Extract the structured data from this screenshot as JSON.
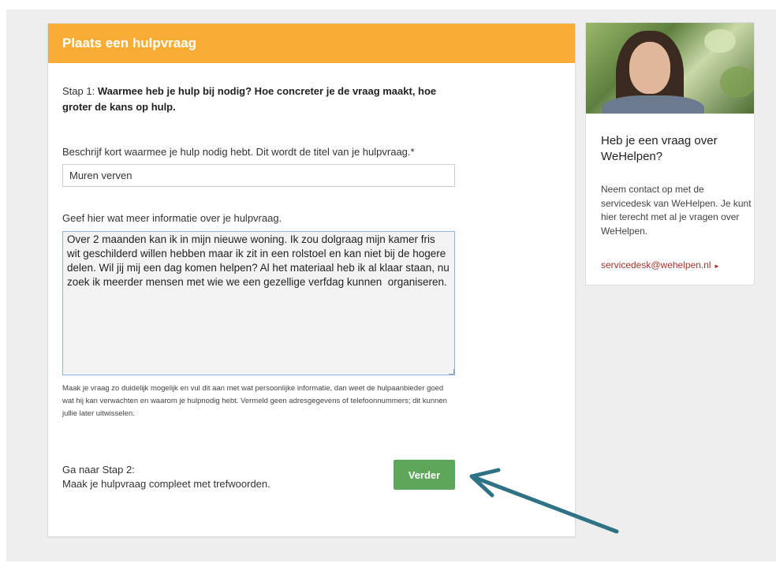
{
  "form": {
    "header_title": "Plaats een hulpvraag",
    "step_text_prefix": "Stap 1: ",
    "step_text_bold": "Waarmee heb je hulp bij nodig? Hoe concreter je de vraag maakt, hoe groter de kans op hulp.",
    "title_label": "Beschrijf kort waarmee je hulp nodig hebt. Dit wordt de titel van je hulpvraag.*",
    "title_value": "Muren verven",
    "info_label": "Geef hier wat meer informatie over je hulpvraag.",
    "info_value": "Over 2 maanden kan ik in mijn nieuwe woning. Ik zou dolgraag mijn kamer fris wit geschilderd willen hebben maar ik zit in een rolstoel en kan niet bij de hogere delen. Wil jij mij een dag komen helpen? Al het materiaal heb ik al klaar staan, nu zoek ik meerder mensen met wie we een gezellige verfdag kunnen  organiseren.",
    "help_text": "Maak je vraag zo duidelijk mogelijk en vul dit aan met wat persoonlijke informatie, dan weet de hulpaanbieder goed wat hij kan verwachten en waarom je hulpnodig hebt. Vermeld geen adresgegevens of telefoonnummers; dit kunnen jullie later uitwisselen.",
    "next_step_line1": "Ga naar Stap 2:",
    "next_step_line2": "Maak je hulpvraag compleet met trefwoorden.",
    "next_button_label": "Verder"
  },
  "sidebar": {
    "heading": "Heb je een vraag over WeHelpen?",
    "body": "Neem contact op met de servicedesk van WeHelpen. Je kunt hier terecht met al je vragen over WeHelpen.",
    "link_label": "servicedesk@wehelpen.nl",
    "link_arrow": "►"
  },
  "colors": {
    "header_orange": "#f9ad36",
    "button_green": "#5ea65a",
    "link_red": "#a9342b",
    "annotation_arrow": "#2f7185"
  },
  "icons": {
    "photo": "woman-portrait-photo",
    "annotation": "annotation-arrow-icon"
  }
}
